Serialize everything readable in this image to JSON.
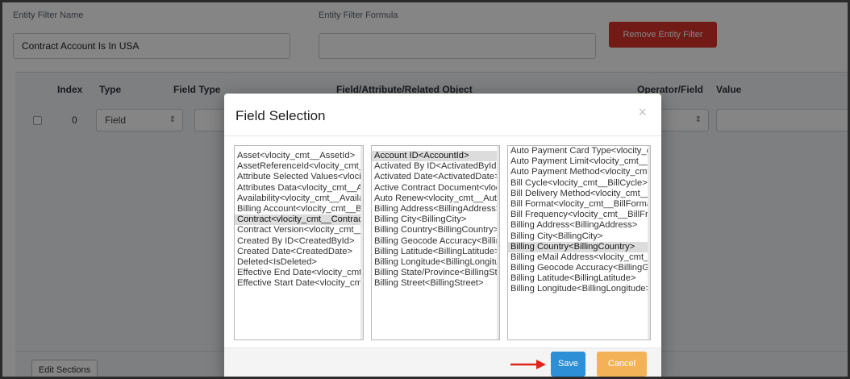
{
  "filter": {
    "name_label": "Entity Filter Name",
    "name_value": "Contract Account Is In USA",
    "formula_label": "Entity Filter Formula",
    "formula_value": "",
    "remove_button": "Remove Entity Filter"
  },
  "table": {
    "headers": {
      "index": "Index",
      "type": "Type",
      "field_type": "Field Type",
      "field": "Field/Attribute/Related Object",
      "operator": "Operator/Field",
      "value": "Value"
    },
    "row": {
      "index": "0",
      "type": "Field"
    }
  },
  "footer": {
    "edit_sections": "Edit Sections"
  },
  "modal": {
    "title": "Field Selection",
    "close": "×",
    "list1": [
      "Asset<vlocity_cmt__AssetId>",
      "AssetReferenceId<vlocity_cmt__AssetReferenceId>",
      "Attribute Selected Values<vlocity_cmt__AttributeSelectedValues>",
      "Attributes Data<vlocity_cmt__AttributesData>",
      "Availability<vlocity_cmt__Availability>",
      "Billing Account<vlocity_cmt__BillingAccountId>",
      "Contract<vlocity_cmt__ContractId>",
      "Contract Version<vlocity_cmt__ContractVersionId>",
      "Created By ID<CreatedById>",
      "Created Date<CreatedDate>",
      "Deleted<IsDeleted>",
      "Effective End Date<vlocity_cmt__EffectiveEndDate>",
      "Effective Start Date<vlocity_cmt__EffectiveStartDate>"
    ],
    "list1_selected": 6,
    "list2": [
      "Account ID<AccountId>",
      "Activated By ID<ActivatedById>",
      "Activated Date<ActivatedDate>",
      "Active Contract Document<vlocity_cmt__ActiveContractDocument>",
      "Auto Renew<vlocity_cmt__AutoRenew>",
      "Billing Address<BillingAddress>",
      "Billing City<BillingCity>",
      "Billing Country<BillingCountry>",
      "Billing Geocode Accuracy<BillingGeocodeAccuracy>",
      "Billing Latitude<BillingLatitude>",
      "Billing Longitude<BillingLongitude>",
      "Billing State/Province<BillingState>",
      "Billing Street<BillingStreet>"
    ],
    "list2_selected": 0,
    "list3": [
      "Auto Payment Card Type<vlocity_cmt__AutoPaymentCardType>",
      "Auto Payment Limit<vlocity_cmt__AutoPaymentLimit>",
      "Auto Payment Method<vlocity_cmt__AutoPaymentMethod>",
      "Bill Cycle<vlocity_cmt__BillCycle>",
      "Bill Delivery Method<vlocity_cmt__BillDeliveryMethod>",
      "Bill Format<vlocity_cmt__BillFormat>",
      "Bill Frequency<vlocity_cmt__BillFrequency>",
      "Billing Address<BillingAddress>",
      "Billing City<BillingCity>",
      "Billing Country<BillingCountry>",
      "Billing eMail Address<vlocity_cmt__BillingEmailAddress>",
      "Billing Geocode Accuracy<BillingGeocodeAccuracy>",
      "Billing Latitude<BillingLatitude>",
      "Billing Longitude<BillingLongitude>"
    ],
    "list3_selected": 9,
    "save": "Save",
    "cancel": "Cancel"
  },
  "colors": {
    "danger": "#d9322b",
    "save": "#2d8fd6",
    "cancel": "#f4b258",
    "arrow": "#e0261c"
  },
  "icons": {
    "select_chevron": "chevron-updown-icon",
    "close": "close-icon",
    "arrow": "right-arrow-icon"
  }
}
